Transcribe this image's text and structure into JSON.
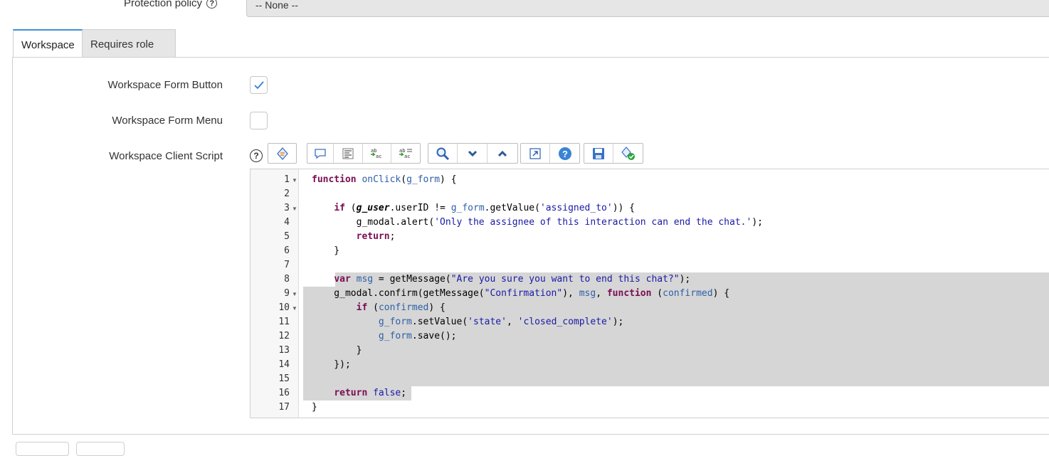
{
  "protection_policy": {
    "label": "Protection policy",
    "help": "?",
    "value": "-- None --"
  },
  "tabs": [
    {
      "label": "Workspace",
      "active": true
    },
    {
      "label": "Requires role",
      "active": false
    }
  ],
  "fields": {
    "form_button": {
      "label": "Workspace Form Button",
      "checked": true
    },
    "form_menu": {
      "label": "Workspace Form Menu",
      "checked": false
    },
    "client_script": {
      "label": "Workspace Client Script",
      "help": "?"
    }
  },
  "toolbar_icons": [
    "script-assist-icon",
    "comment-icon",
    "format-code-icon",
    "replace-icon",
    "replace-all-icon",
    "search-icon",
    "chevron-down-icon",
    "chevron-up-icon",
    "fullscreen-icon",
    "help-icon",
    "save-icon",
    "syntax-check-icon"
  ],
  "colors": {
    "accent": "#3d8fd6",
    "keyword": "#7a0c52",
    "string": "#1a1aa6",
    "selection": "#d6d6d6"
  },
  "code": {
    "line_numbers": [
      "1",
      "2",
      "3",
      "4",
      "5",
      "6",
      "7",
      "8",
      "9",
      "10",
      "11",
      "12",
      "13",
      "14",
      "15",
      "16",
      "17"
    ],
    "lines": [
      "function onClick(g_form) {",
      "",
      "    if (g_user.userID != g_form.getValue('assigned_to')) {",
      "        g_modal.alert('Only the assignee of this interaction can end the chat.');",
      "        return;",
      "    }",
      "",
      "    var msg = getMessage(\"Are you sure you want to end this chat?\");",
      "    g_modal.confirm(getMessage(\"Confirmation\"), msg, function (confirmed) {",
      "        if (confirmed) {",
      "            g_form.setValue('state', 'closed_complete');",
      "            g_form.save();",
      "        }",
      "    });",
      "",
      "    return false;",
      "}"
    ]
  }
}
